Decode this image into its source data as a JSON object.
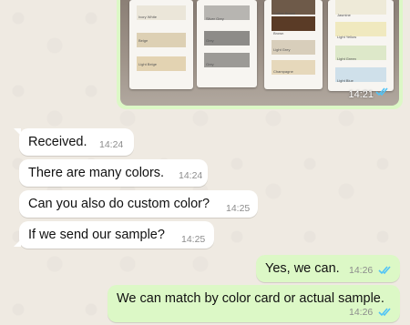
{
  "image_message": {
    "time": "14:21",
    "status_icon": "double-check-blue-icon",
    "card_labels": [
      "Ivory White",
      "Beige",
      "Light Beige",
      "Silver Grey",
      "Grey",
      "Grey",
      "Coffee Brown",
      "Brown",
      "Light Grey",
      "Champagne",
      "Jasmine",
      "Light Yellow",
      "Light Green",
      "Light Blue"
    ]
  },
  "messages": [
    {
      "direction": "in",
      "text": "Received.",
      "time": "14:24"
    },
    {
      "direction": "in",
      "text": "There are many colors.",
      "time": "14:24"
    },
    {
      "direction": "in",
      "text": "Can you also do custom color?",
      "time": "14:25"
    },
    {
      "direction": "in",
      "text": "If we send our sample?",
      "time": "14:25"
    },
    {
      "direction": "out",
      "text": "Yes, we can.",
      "time": "14:26",
      "status_icon": "double-check-blue-icon"
    },
    {
      "direction": "out",
      "text": "We can match by color card or actual sample.",
      "time": "14:26",
      "status_icon": "double-check-blue-icon"
    }
  ],
  "colors": {
    "incoming_bubble": "#ffffff",
    "outgoing_bubble": "#dcf8c6",
    "read_tick": "#4fc3f7",
    "timestamp": "#8c8c8c"
  }
}
